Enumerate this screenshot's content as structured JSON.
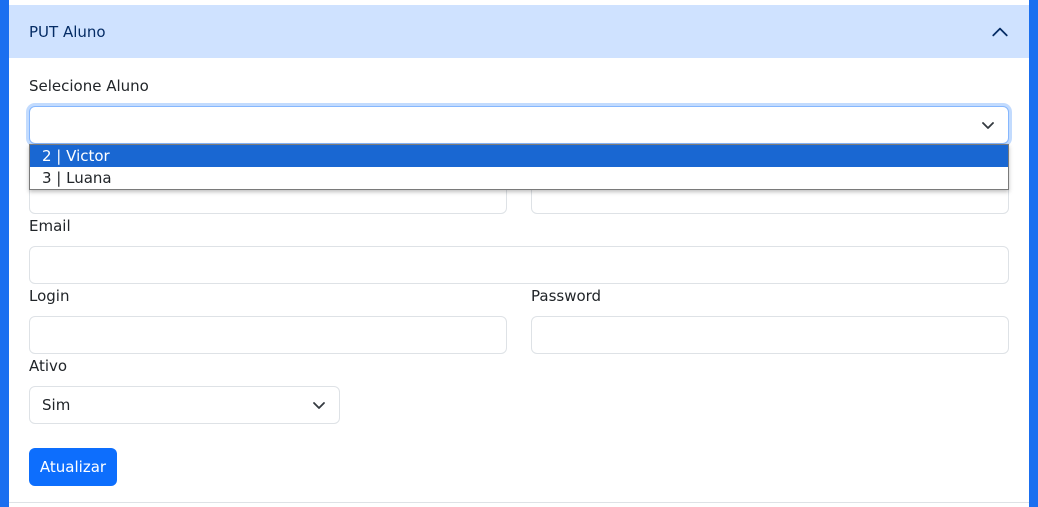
{
  "accordion": {
    "title": "PUT Aluno",
    "expanded": true
  },
  "form": {
    "aluno_select": {
      "label": "Selecione Aluno",
      "value": "",
      "options": [
        {
          "label": "2 | Victor",
          "highlighted": true
        },
        {
          "label": "3 | Luana",
          "highlighted": false
        }
      ]
    },
    "email": {
      "label": "Email",
      "value": ""
    },
    "login": {
      "label": "Login",
      "value": ""
    },
    "password": {
      "label": "Password",
      "value": ""
    },
    "ativo": {
      "label": "Ativo",
      "value": "Sim"
    },
    "submit_label": "Atualizar"
  },
  "colors": {
    "page_background": "#1a6ff0",
    "header_background": "#cfe2ff",
    "primary": "#0d6efd",
    "option_highlight": "#1967d2"
  },
  "icons": {
    "accordion_toggle": "chevron-up-icon",
    "select_arrow": "chevron-down-icon"
  }
}
